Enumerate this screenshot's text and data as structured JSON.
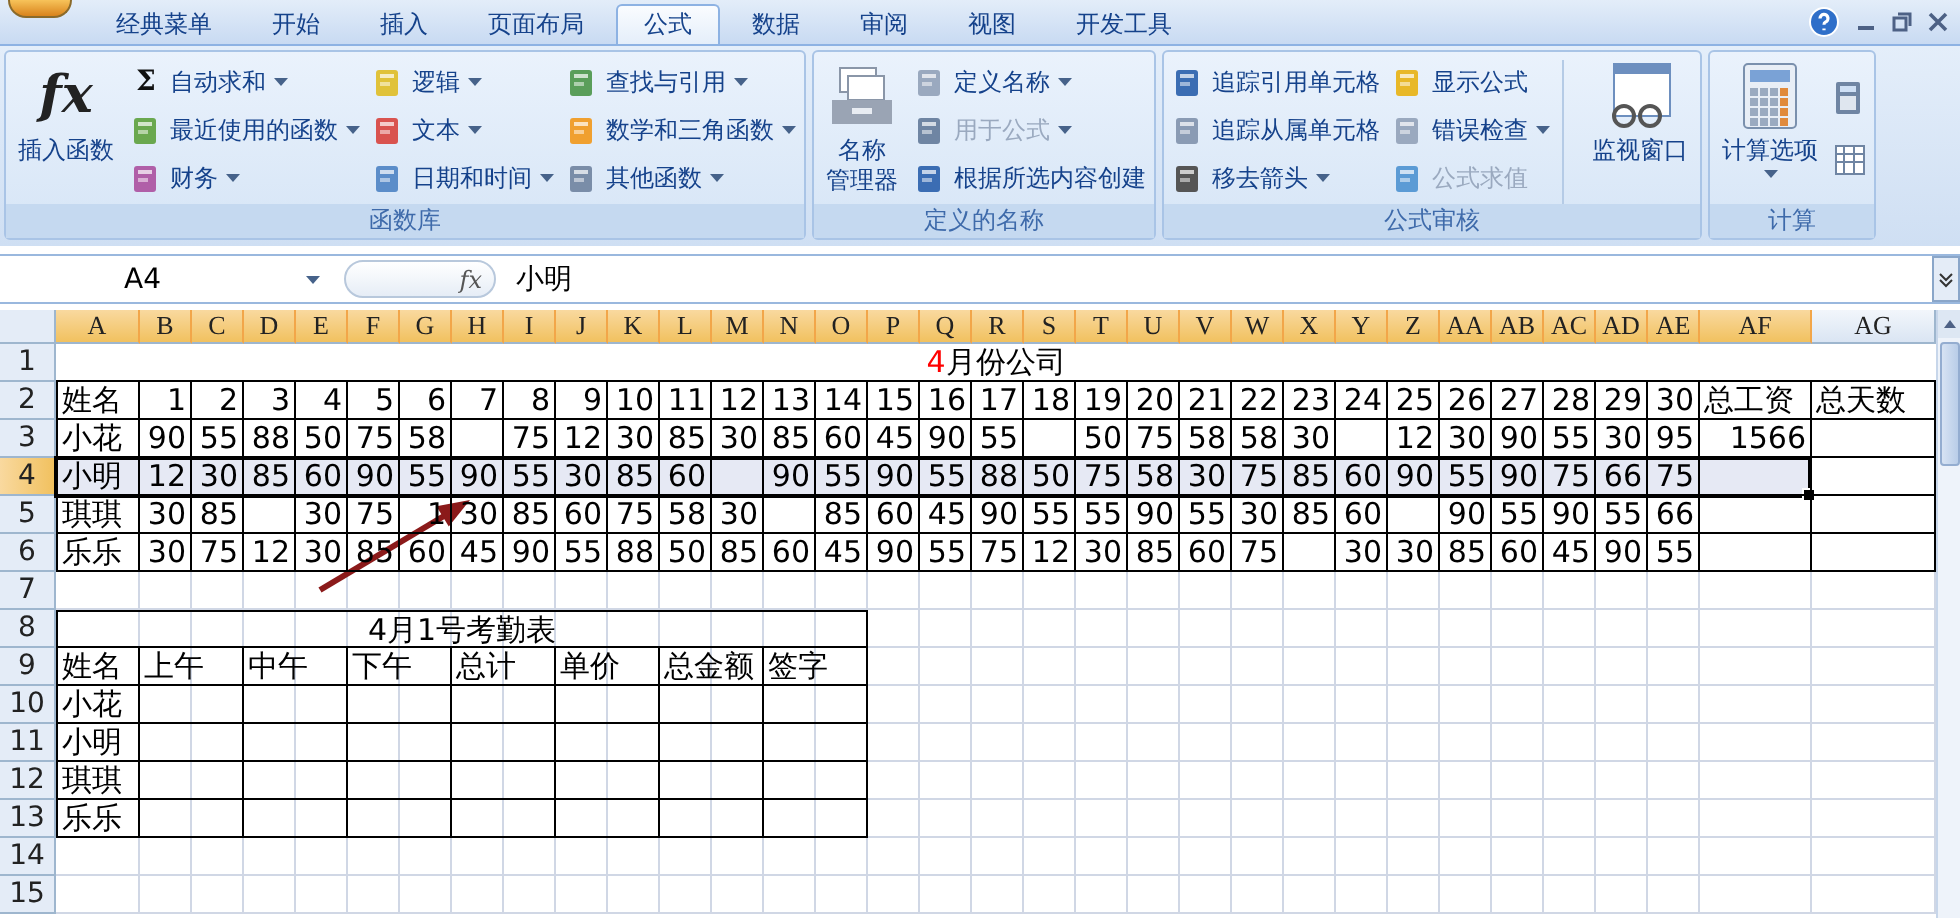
{
  "ribbon": {
    "tabs": [
      {
        "label": "经典菜单",
        "selected": false
      },
      {
        "label": "开始",
        "selected": false
      },
      {
        "label": "插入",
        "selected": false
      },
      {
        "label": "页面布局",
        "selected": false
      },
      {
        "label": "公式",
        "selected": true
      },
      {
        "label": "数据",
        "selected": false
      },
      {
        "label": "审阅",
        "selected": false
      },
      {
        "label": "视图",
        "selected": false
      },
      {
        "label": "开发工具",
        "selected": false
      }
    ],
    "groups": [
      {
        "label": "函数库",
        "items": [
          {
            "kind": "large",
            "lines": [
              "插入函数"
            ],
            "glyph": "fx",
            "dropdown": false
          },
          {
            "kind": "stack",
            "buttons": [
              {
                "label": "自动求和",
                "glyph": "Σ",
                "dropdown": true,
                "disabled": false
              },
              {
                "label": "最近使用的函数",
                "dropdown": true,
                "disabled": false
              },
              {
                "label": "财务",
                "dropdown": true,
                "disabled": false
              }
            ]
          },
          {
            "kind": "stack",
            "buttons": [
              {
                "label": "逻辑",
                "dropdown": true,
                "disabled": false
              },
              {
                "label": "文本",
                "dropdown": true,
                "disabled": false
              },
              {
                "label": "日期和时间",
                "dropdown": true,
                "disabled": false
              }
            ]
          },
          {
            "kind": "stack",
            "buttons": [
              {
                "label": "查找与引用",
                "dropdown": true,
                "disabled": false
              },
              {
                "label": "数学和三角函数",
                "dropdown": true,
                "disabled": false
              },
              {
                "label": "其他函数",
                "dropdown": true,
                "disabled": false
              }
            ]
          }
        ]
      },
      {
        "label": "定义的名称",
        "items": [
          {
            "kind": "large",
            "lines": [
              "名称",
              "管理器"
            ],
            "dropdown": false
          },
          {
            "kind": "stack",
            "buttons": [
              {
                "label": "定义名称",
                "dropdown": true,
                "disabled": false
              },
              {
                "label": "用于公式",
                "dropdown": true,
                "disabled": true
              },
              {
                "label": "根据所选内容创建",
                "dropdown": false,
                "disabled": false
              }
            ]
          }
        ]
      },
      {
        "label": "公式审核",
        "items": [
          {
            "kind": "stack",
            "buttons": [
              {
                "label": "追踪引用单元格",
                "dropdown": false,
                "disabled": false
              },
              {
                "label": "追踪从属单元格",
                "dropdown": false,
                "disabled": false
              },
              {
                "label": "移去箭头",
                "dropdown": true,
                "disabled": false
              }
            ]
          },
          {
            "kind": "stack",
            "buttons": [
              {
                "label": "显示公式",
                "dropdown": false,
                "disabled": false
              },
              {
                "label": "错误检查",
                "dropdown": true,
                "disabled": false
              },
              {
                "label": "公式求值",
                "dropdown": false,
                "disabled": true
              }
            ]
          },
          {
            "kind": "large",
            "lines": [
              "监视窗口"
            ],
            "dropdown": false
          }
        ]
      },
      {
        "label": "计算",
        "items": [
          {
            "kind": "large",
            "lines": [
              "计算选项"
            ],
            "dropdown": true
          },
          {
            "kind": "icons"
          }
        ]
      }
    ]
  },
  "formula_bar": {
    "name_box": "A4",
    "fx": "fx",
    "value": "小明"
  },
  "sheet": {
    "column_headers": [
      {
        "label": "A",
        "selected": true
      },
      {
        "label": "B",
        "selected": true
      },
      {
        "label": "C",
        "selected": true
      },
      {
        "label": "D",
        "selected": true
      },
      {
        "label": "E",
        "selected": true
      },
      {
        "label": "F",
        "selected": true
      },
      {
        "label": "G",
        "selected": true
      },
      {
        "label": "H",
        "selected": true
      },
      {
        "label": "I",
        "selected": true
      },
      {
        "label": "J",
        "selected": true
      },
      {
        "label": "K",
        "selected": true
      },
      {
        "label": "L",
        "selected": true
      },
      {
        "label": "M",
        "selected": true
      },
      {
        "label": "N",
        "selected": true
      },
      {
        "label": "O",
        "selected": true
      },
      {
        "label": "P",
        "selected": true
      },
      {
        "label": "Q",
        "selected": true
      },
      {
        "label": "R",
        "selected": true
      },
      {
        "label": "S",
        "selected": true
      },
      {
        "label": "T",
        "selected": true
      },
      {
        "label": "U",
        "selected": true
      },
      {
        "label": "V",
        "selected": true
      },
      {
        "label": "W",
        "selected": true
      },
      {
        "label": "X",
        "selected": true
      },
      {
        "label": "Y",
        "selected": true
      },
      {
        "label": "Z",
        "selected": true
      },
      {
        "label": "AA",
        "selected": true
      },
      {
        "label": "AB",
        "selected": true
      },
      {
        "label": "AC",
        "selected": true
      },
      {
        "label": "AD",
        "selected": true
      },
      {
        "label": "AE",
        "selected": true
      },
      {
        "label": "AF",
        "selected": true
      },
      {
        "label": "AG",
        "selected": false
      }
    ],
    "row_headers": [
      {
        "label": "1",
        "selected": false
      },
      {
        "label": "2",
        "selected": false
      },
      {
        "label": "3",
        "selected": false
      },
      {
        "label": "4",
        "selected": true
      },
      {
        "label": "5",
        "selected": false
      },
      {
        "label": "6",
        "selected": false
      },
      {
        "label": "7",
        "selected": false
      },
      {
        "label": "8",
        "selected": false
      },
      {
        "label": "9",
        "selected": false
      },
      {
        "label": "10",
        "selected": false
      },
      {
        "label": "11",
        "selected": false
      },
      {
        "label": "12",
        "selected": false
      },
      {
        "label": "13",
        "selected": false
      },
      {
        "label": "14",
        "selected": false
      },
      {
        "label": "15",
        "selected": false
      }
    ],
    "month_title": [
      {
        "text": "4",
        "color": "#ff0000"
      },
      {
        "text": "月份公司",
        "color": "#000000"
      }
    ],
    "month_table": {
      "header": [
        "姓名",
        "1",
        "2",
        "3",
        "4",
        "5",
        "6",
        "7",
        "8",
        "9",
        "10",
        "11",
        "12",
        "13",
        "14",
        "15",
        "16",
        "17",
        "18",
        "19",
        "20",
        "21",
        "22",
        "23",
        "24",
        "25",
        "26",
        "27",
        "28",
        "29",
        "30",
        "总工资",
        "总天数"
      ],
      "rows": [
        {
          "selected": false,
          "cells": [
            "小花",
            "90",
            "55",
            "88",
            "50",
            "75",
            "58",
            null,
            "75",
            "12",
            "30",
            "85",
            "30",
            "85",
            "60",
            "45",
            "90",
            "55",
            null,
            "50",
            "75",
            "58",
            "58",
            "30",
            null,
            "12",
            "30",
            "90",
            "55",
            "30",
            "95",
            "1566",
            null
          ]
        },
        {
          "selected": true,
          "cells": [
            "小明",
            "12",
            "30",
            "85",
            "60",
            "90",
            "55",
            "90",
            "55",
            "30",
            "85",
            "60",
            null,
            "90",
            "55",
            "90",
            "55",
            "88",
            "50",
            "75",
            "58",
            "30",
            "75",
            "85",
            "60",
            "90",
            "55",
            "90",
            "75",
            "66",
            "75",
            null,
            null
          ]
        },
        {
          "selected": false,
          "cells": [
            "琪琪",
            "30",
            "85",
            null,
            "30",
            "75",
            "1",
            "30",
            "85",
            "60",
            "75",
            "58",
            "30",
            null,
            "85",
            "60",
            "45",
            "90",
            "55",
            "55",
            "90",
            "55",
            "30",
            "85",
            "60",
            null,
            "90",
            "55",
            "90",
            "55",
            "66",
            null,
            null
          ]
        },
        {
          "selected": false,
          "cells": [
            "乐乐",
            "30",
            "75",
            "12",
            "30",
            "85",
            "60",
            "45",
            "90",
            "55",
            "88",
            "50",
            "85",
            "60",
            "45",
            "90",
            "55",
            "75",
            "12",
            "30",
            "85",
            "60",
            "75",
            null,
            "30",
            "30",
            "85",
            "60",
            "45",
            "90",
            "55",
            null,
            null
          ]
        }
      ]
    },
    "day_table": {
      "title": "4月1号考勤表",
      "header": [
        "姓名",
        "上午",
        "中午",
        "下午",
        "总计",
        "单价",
        "总金额",
        "签字"
      ],
      "names": [
        "小花",
        "小明",
        "琪琪",
        "乐乐"
      ]
    }
  }
}
